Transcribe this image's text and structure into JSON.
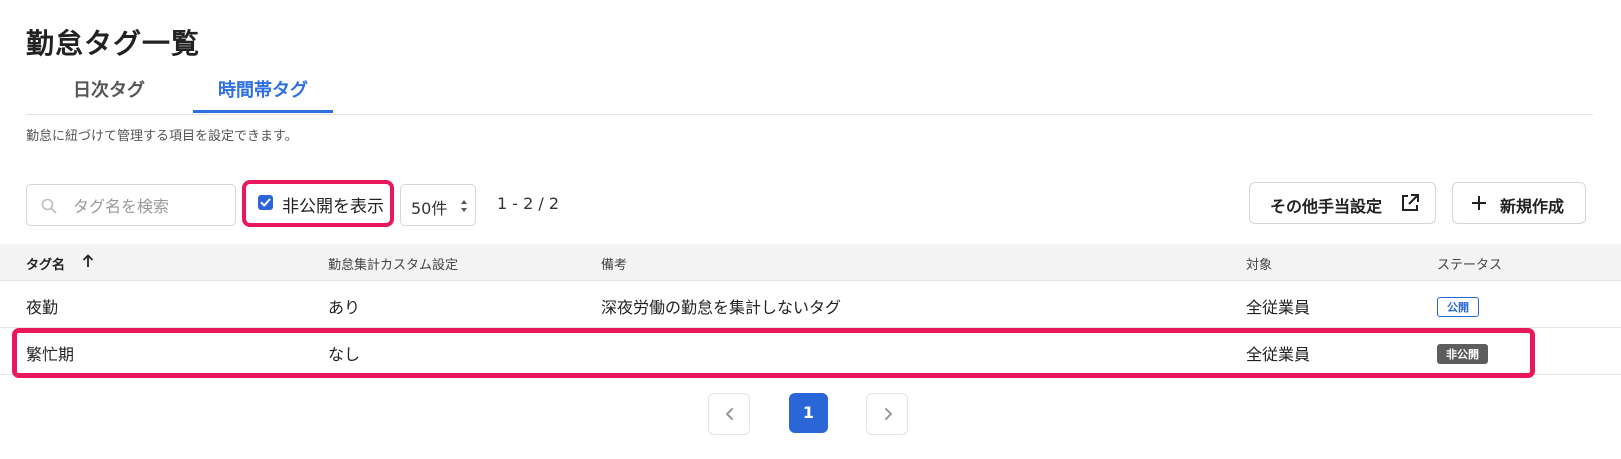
{
  "page": {
    "title": "勤怠タグ一覧",
    "description": "勤怠に紐づけて管理する項目を設定できます。"
  },
  "tabs": [
    {
      "label": "日次タグ",
      "active": false
    },
    {
      "label": "時間帯タグ",
      "active": true
    }
  ],
  "toolbar": {
    "search_placeholder": "タグ名を検索",
    "search_icon": "search-icon",
    "show_hidden_label": "非公開を表示",
    "show_hidden_checked": true,
    "per_page_value": "50件",
    "range_text": "1 - 2 / 2",
    "other_allowance_label": "その他手当設定",
    "other_allowance_icon": "external-link-icon",
    "new_label": "新規作成",
    "new_icon": "plus-icon"
  },
  "table": {
    "columns": [
      "タグ名",
      "勤怠集計カスタム設定",
      "備考",
      "対象",
      "ステータス"
    ],
    "sort_icon": "arrow-up-icon",
    "rows": [
      {
        "name": "夜勤",
        "custom": "あり",
        "note": "深夜労働の勤怠を集計しないタグ",
        "target": "全従業員",
        "status": "公開"
      },
      {
        "name": "繁忙期",
        "custom": "なし",
        "note": "",
        "target": "全従業員",
        "status": "非公開"
      }
    ]
  },
  "pagination": {
    "current_page": "1",
    "prev_icon": "chevron-left-icon",
    "next_icon": "chevron-right-icon"
  },
  "colors": {
    "accent": "#2b66d9",
    "highlight": "#e8185a",
    "private_badge": "#5d5d5d"
  }
}
